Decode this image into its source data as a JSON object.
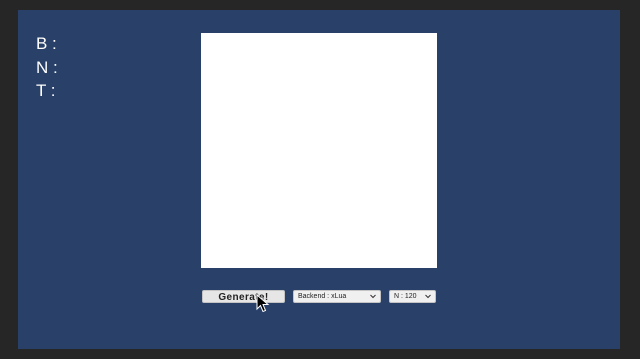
{
  "stats": [
    {
      "label": "B :",
      "value": ""
    },
    {
      "label": "N :",
      "value": ""
    },
    {
      "label": "T :",
      "value": ""
    }
  ],
  "controls": {
    "generate_label": "Generate!",
    "backend_select": {
      "selected": "Backend : xLua"
    },
    "count_select": {
      "selected": "N : 120"
    }
  },
  "colors": {
    "background": "#294169",
    "canvas": "#ffffff"
  },
  "icons": {
    "dropdown": "chevron-down-icon",
    "pointer": "mouse-cursor-icon"
  }
}
